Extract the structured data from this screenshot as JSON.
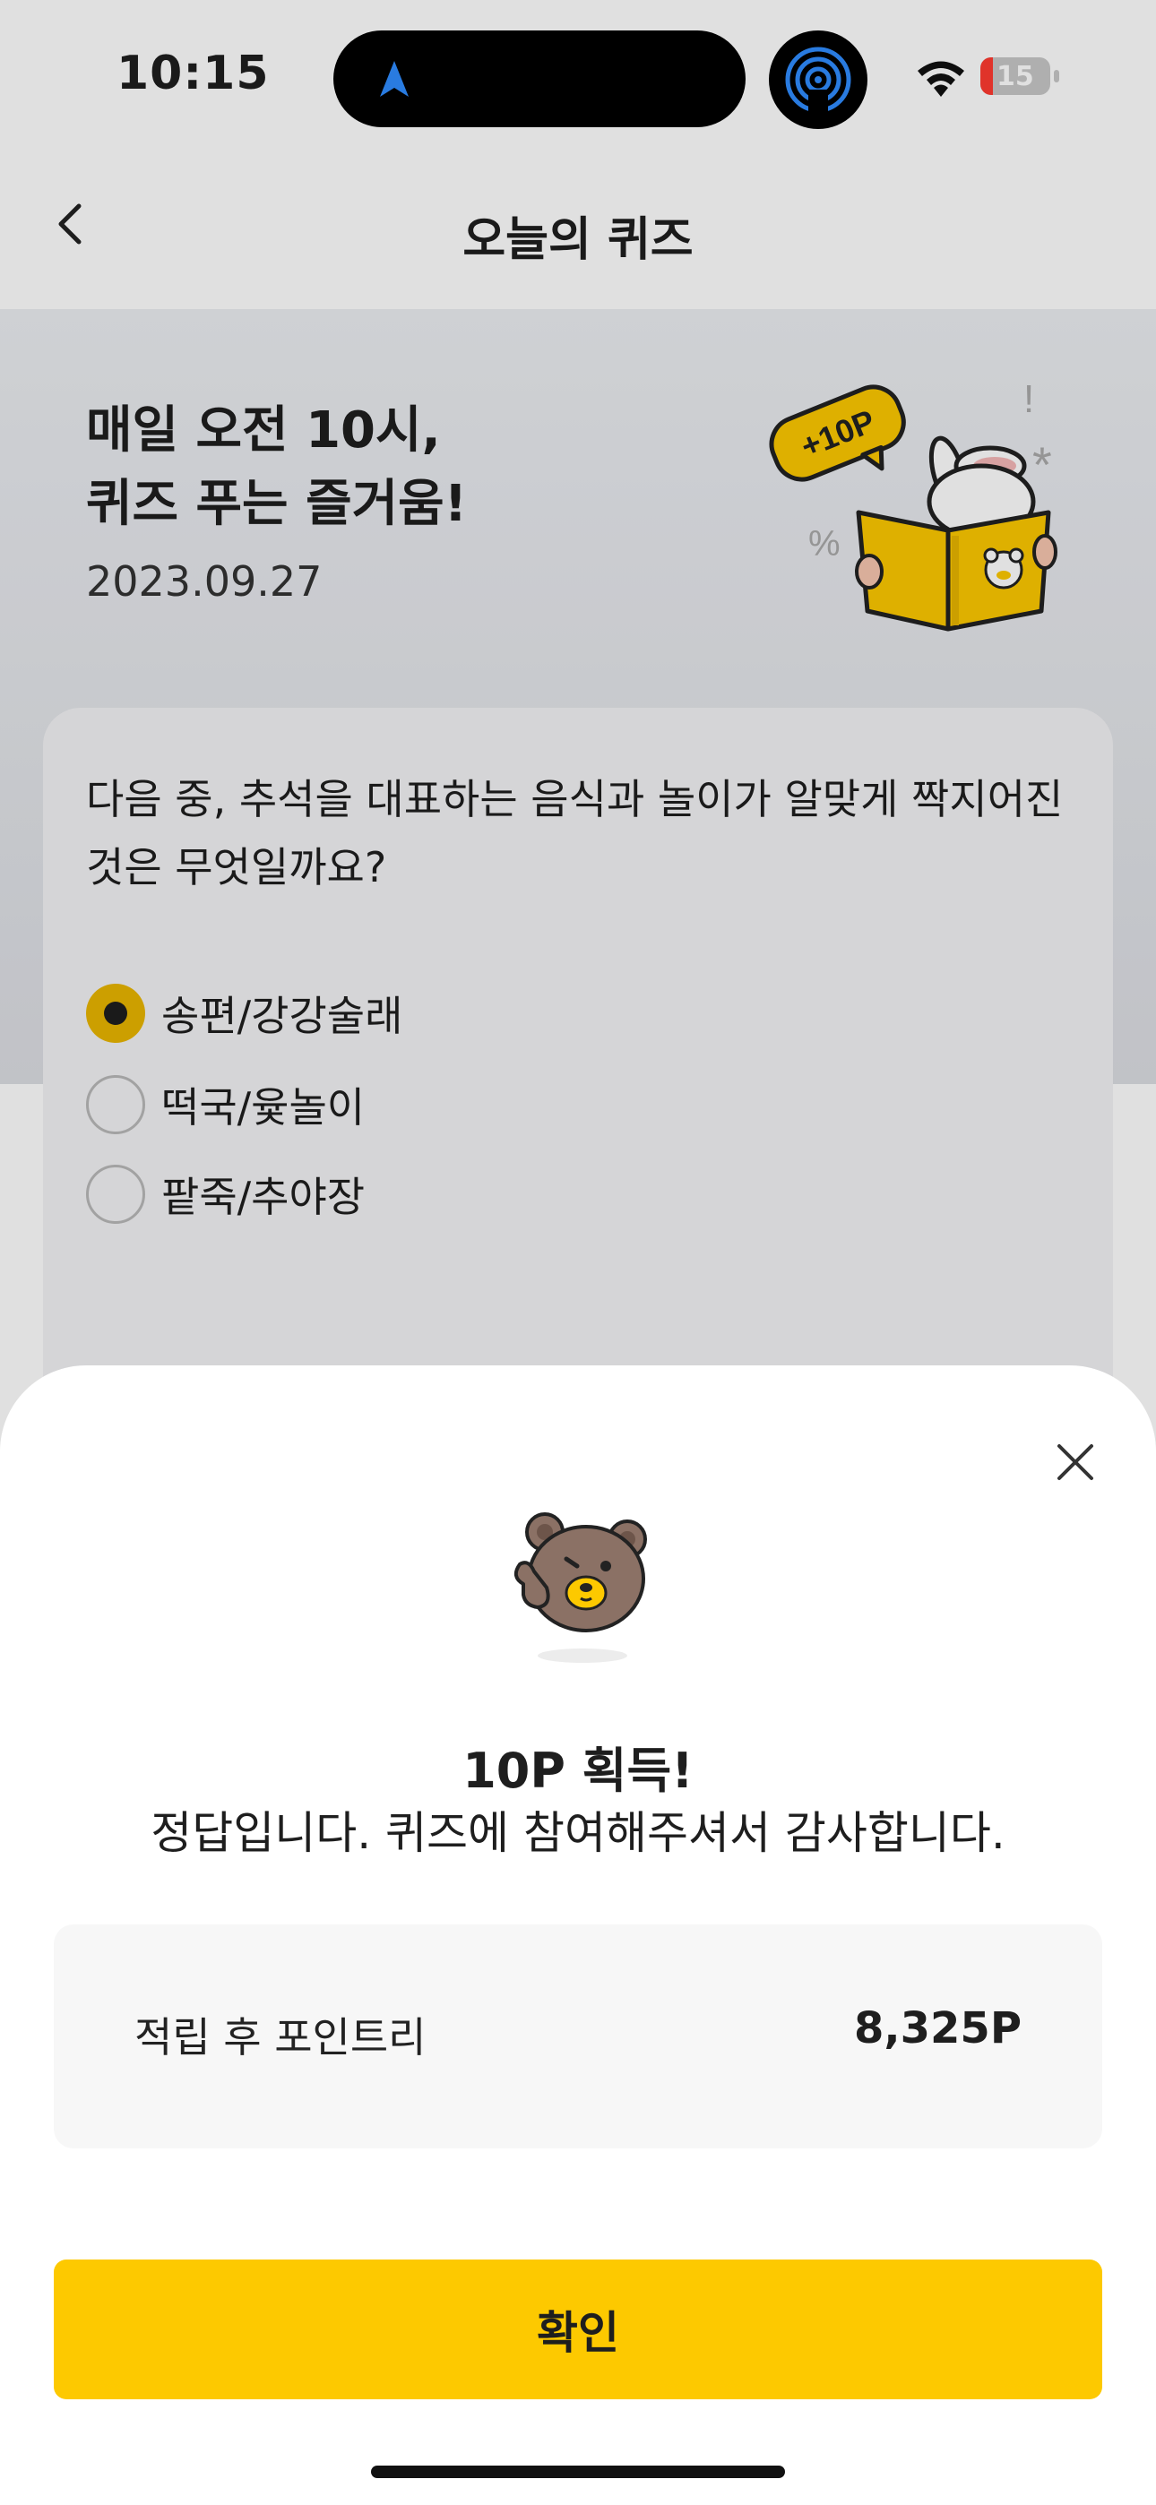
{
  "status_bar": {
    "time": "10:15",
    "battery_percent": "15",
    "battery_color": "#ff3b30",
    "icons": [
      "navigation-arrow-icon",
      "airdrop-icon",
      "wifi-icon",
      "battery-icon"
    ]
  },
  "nav": {
    "title": "오늘의 퀴즈",
    "back_icon": "chevron-left-icon"
  },
  "hero": {
    "title_line1": "매일 오전 10시,",
    "title_line2": "퀴즈 푸는 즐거움!",
    "date": "2023.09.27",
    "badge_text": "+10P"
  },
  "quiz": {
    "question": "다음 중, 추석을 대표하는 음식과 놀이가 알맞게 짝지어진 것은 무엇일까요?",
    "options": [
      {
        "label": "송편/강강술래",
        "selected": true
      },
      {
        "label": "떡국/윷놀이",
        "selected": false
      },
      {
        "label": "팥죽/추야장",
        "selected": false
      }
    ]
  },
  "result_sheet": {
    "title": "10P 획득!",
    "message": "정답입니다. 퀴즈에 참여해주셔서 감사합니다.",
    "points_label": "적립 후 포인트리",
    "points_value": "8,325P",
    "confirm_label": "확인",
    "close_icon": "close-icon"
  },
  "colors": {
    "accent_yellow": "#fdc900",
    "selected_radio": "#e9b500"
  }
}
